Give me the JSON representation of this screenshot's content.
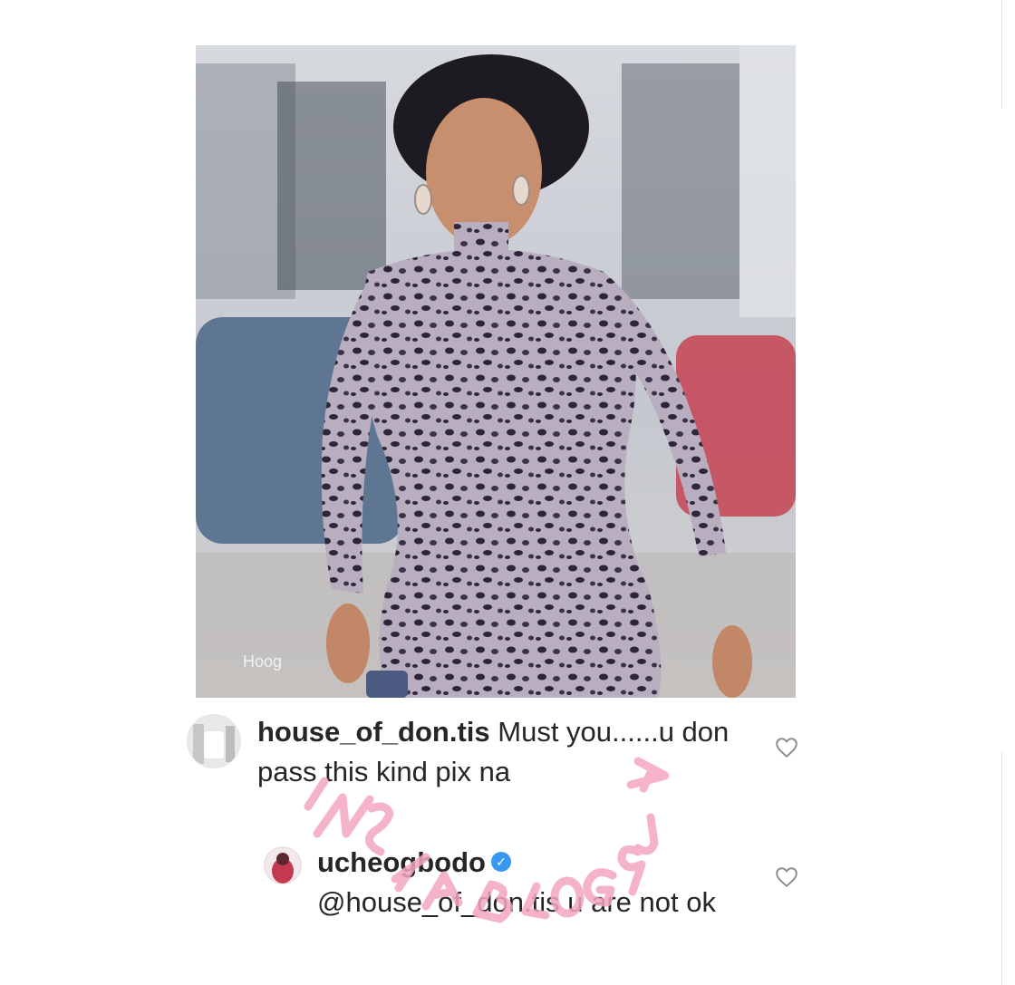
{
  "post": {
    "image_watermark_text": "Hoog"
  },
  "comments": [
    {
      "username": "house_of_don.tis",
      "text": " Must you......u don pass this kind pix na",
      "verified": false,
      "like_icon": "heart-outline-icon"
    },
    {
      "username": "ucheogbodo",
      "mention": "@house_of_don.tis",
      "text": " u are not ok",
      "verified": true,
      "like_icon": "heart-outline-icon"
    }
  ],
  "overlay_watermark": {
    "text": "INSTABLOG9JA",
    "color": "#f4a6bf"
  },
  "colors": {
    "text": "#262626",
    "verified_badge": "#3897f0",
    "heart_stroke": "#8e8e8e"
  }
}
